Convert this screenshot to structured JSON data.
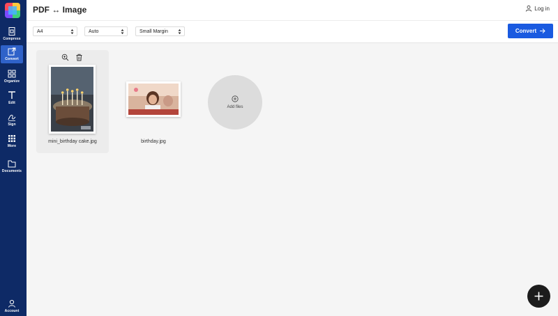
{
  "header": {
    "title": "PDF ↔ Image",
    "login_label": "Log in"
  },
  "sidebar": {
    "items": [
      {
        "label": "Compress",
        "icon": "compress-icon"
      },
      {
        "label": "Convert",
        "icon": "convert-icon",
        "active": true
      },
      {
        "label": "Organize",
        "icon": "organize-icon"
      },
      {
        "label": "Edit",
        "icon": "edit-icon"
      },
      {
        "label": "Sign",
        "icon": "sign-icon"
      },
      {
        "label": "More",
        "icon": "more-icon"
      },
      {
        "label": "Documents",
        "icon": "documents-icon"
      }
    ],
    "account_label": "Account"
  },
  "toolbar": {
    "page_size": "A4",
    "orientation": "Auto",
    "margin": "Small Margin",
    "convert_label": "Convert"
  },
  "files": [
    {
      "name": "mini_birthday cake.jpg",
      "selected": true
    },
    {
      "name": "birthday.jpg",
      "selected": false
    }
  ],
  "add_files_label": "Add files",
  "colors": {
    "sidebar": "#0e2a66",
    "accent": "#1a5ae0",
    "active_nav": "#2f62c9"
  }
}
